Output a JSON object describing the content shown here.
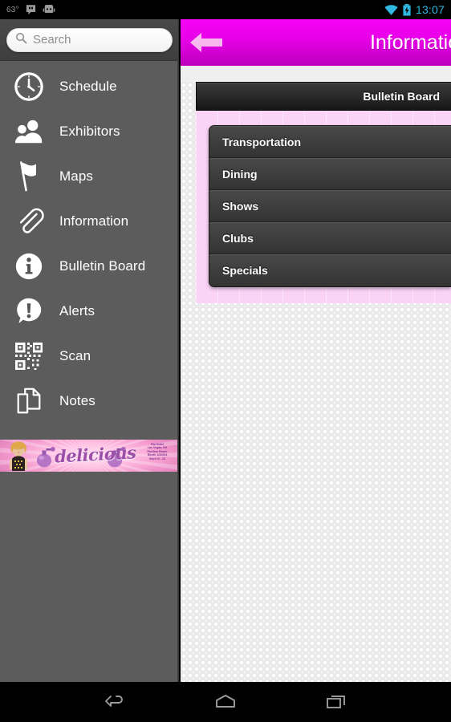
{
  "status_bar": {
    "temperature": "63°",
    "clock": "13:07",
    "icons": [
      "hangouts-icon",
      "android-face-icon",
      "wifi-icon",
      "battery-charging-icon"
    ]
  },
  "sidebar": {
    "search": {
      "placeholder": "Search",
      "value": "",
      "icon": "search-icon"
    },
    "items": [
      {
        "label": "Schedule",
        "icon": "clock-icon"
      },
      {
        "label": "Exhibitors",
        "icon": "people-icon"
      },
      {
        "label": "Maps",
        "icon": "flag-icon"
      },
      {
        "label": "Information",
        "icon": "paperclip-icon"
      },
      {
        "label": "Bulletin Board",
        "icon": "info-circle-icon"
      },
      {
        "label": "Alerts",
        "icon": "alert-bubble-icon"
      },
      {
        "label": "Scan",
        "icon": "qr-code-icon"
      },
      {
        "label": "Notes",
        "icon": "pages-icon"
      }
    ],
    "banner_ad": {
      "word": "delicious",
      "info_lines": [
        "Rio Hotel",
        "Las Vegas, NV",
        "Pavilion Room",
        "Booth 123/234",
        "Sept 10 - 12"
      ]
    }
  },
  "header": {
    "title": "Information",
    "back_icon": "back-arrow-icon"
  },
  "main": {
    "section_title": "Bulletin Board",
    "list_items": [
      {
        "label": "Transportation"
      },
      {
        "label": "Dining"
      },
      {
        "label": "Shows"
      },
      {
        "label": "Clubs"
      },
      {
        "label": "Specials"
      }
    ]
  },
  "nav_bar": {
    "buttons": [
      {
        "name": "back-nav-button",
        "icon": "back-icon"
      },
      {
        "name": "home-nav-button",
        "icon": "home-icon"
      },
      {
        "name": "recents-nav-button",
        "icon": "recents-icon"
      }
    ]
  },
  "colors": {
    "accent_magenta": "#e800e8",
    "panel_pink": "#fbd3f7",
    "sidebar_gray": "#5c5c5c",
    "clock_blue": "#2fb8e0"
  }
}
